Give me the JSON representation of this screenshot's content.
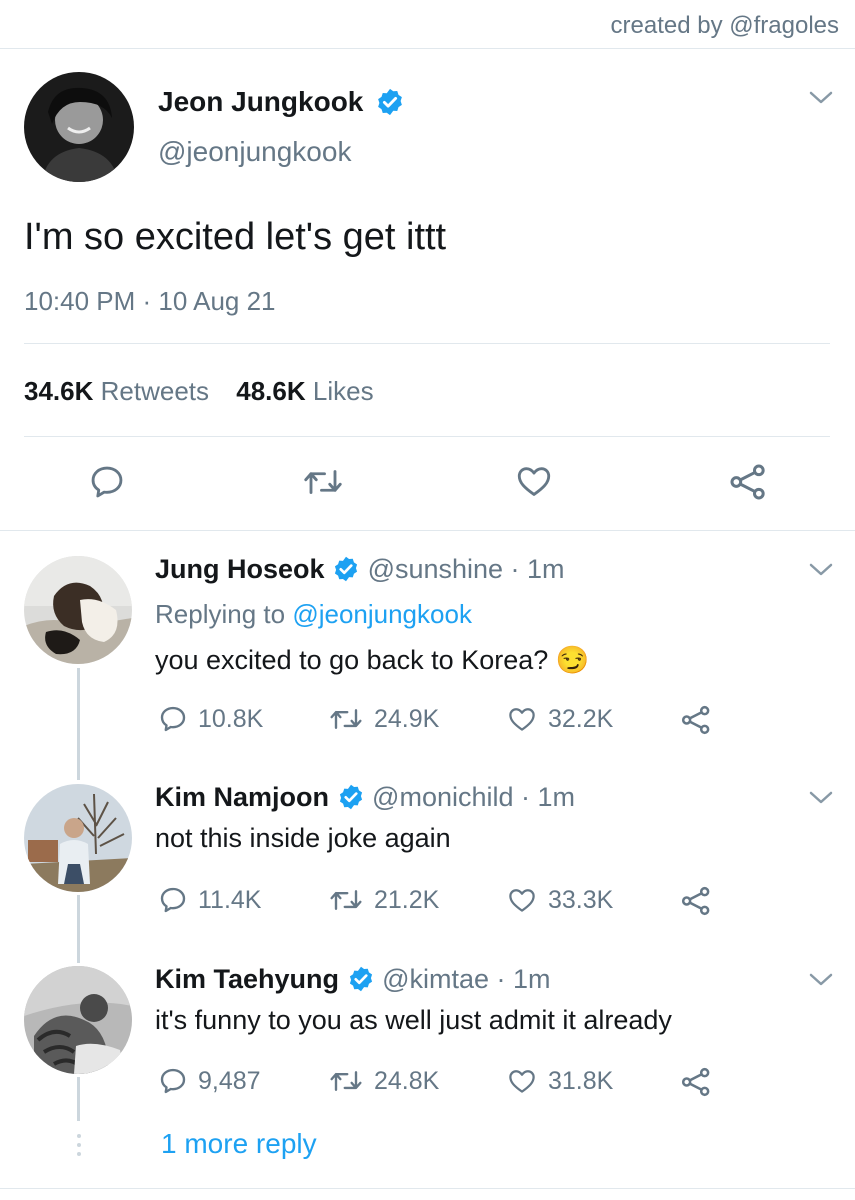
{
  "credit": "created by @fragoles",
  "main_tweet": {
    "name": "Jeon Jungkook",
    "handle": "@jeonjungkook",
    "text": "I'm so excited let's get ittt",
    "timestamp": "10:40 PM · 10 Aug 21",
    "retweets_count": "34.6K",
    "retweets_label": "Retweets",
    "likes_count": "48.6K",
    "likes_label": "Likes"
  },
  "replies": [
    {
      "name": "Jung Hoseok",
      "handle": "@sunshine · 1m",
      "replying_prefix": "Replying to",
      "replying_to": "@jeonjungkook",
      "text": "you excited to go back to Korea? 😏",
      "reply_count": "10.8K",
      "retweet_count": "24.9K",
      "like_count": "32.2K"
    },
    {
      "name": "Kim Namjoon",
      "handle": "@monichild · 1m",
      "text": "not this inside joke again",
      "reply_count": "11.4K",
      "retweet_count": "21.2K",
      "like_count": "33.3K"
    },
    {
      "name": "Kim Taehyung",
      "handle": "@kimtae · 1m",
      "text": "it's funny to you as well just admit it already",
      "reply_count": "9,487",
      "retweet_count": "24.8K",
      "like_count": "31.8K"
    }
  ],
  "more_replies": "1 more reply",
  "colors": {
    "verified": "#1da1f2",
    "link": "#1da1f2",
    "secondary_text": "#657786",
    "divider": "#e1e8ed"
  }
}
